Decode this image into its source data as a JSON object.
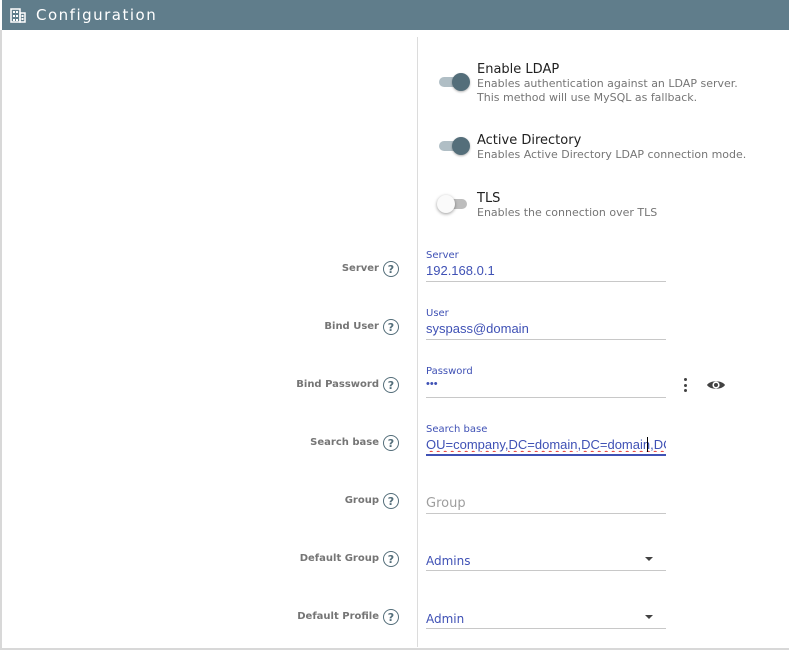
{
  "header": {
    "title": "Configuration",
    "icon": "building-icon"
  },
  "toggles": [
    {
      "title": "Enable LDAP",
      "desc1": "Enables authentication against an LDAP server.",
      "desc2": "This method will use MySQL as fallback.",
      "on": true
    },
    {
      "title": "Active Directory",
      "desc1": "Enables Active Directory LDAP connection mode.",
      "on": true
    },
    {
      "title": "TLS",
      "desc1": "Enables the connection over TLS",
      "on": false
    }
  ],
  "fields": {
    "server": {
      "row_label": "Server",
      "label": "Server",
      "value": "192.168.0.1"
    },
    "bind_user": {
      "row_label": "Bind User",
      "label": "User",
      "value": "syspass@domain"
    },
    "bind_password": {
      "row_label": "Bind Password",
      "label": "Password",
      "value": "•••"
    },
    "search_base": {
      "row_label": "Search base",
      "label": "Search base",
      "value": "OU=company,DC=domain,DC=domain,DC=com"
    },
    "group": {
      "row_label": "Group",
      "placeholder": "Group"
    },
    "default_group": {
      "row_label": "Default Group",
      "value": "Admins"
    },
    "default_profile": {
      "row_label": "Default Profile",
      "value": "Admin"
    }
  },
  "help_glyph": "?",
  "colors": {
    "header": "#607d8b",
    "accent": "#3f51b5",
    "toggle": "#546e7a"
  }
}
